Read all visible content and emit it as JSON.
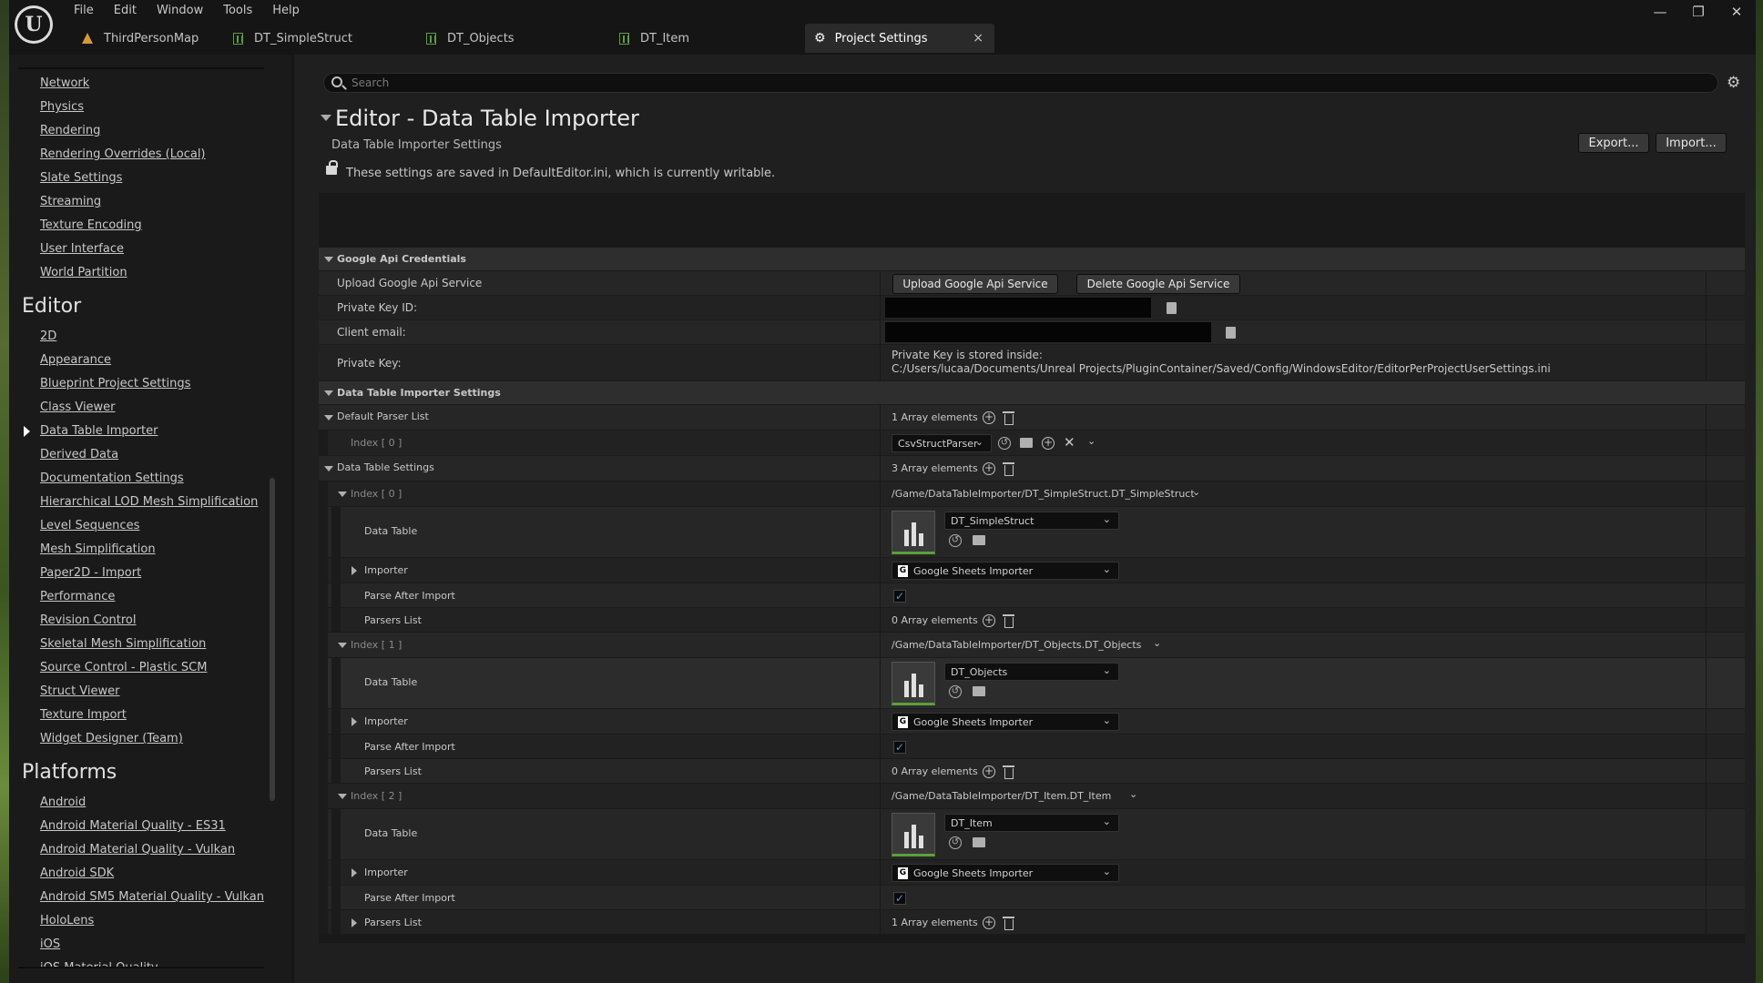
{
  "menu": [
    "File",
    "Edit",
    "Window",
    "Tools",
    "Help"
  ],
  "tabs": [
    {
      "label": "ThirdPersonMap",
      "icon": "map-icon"
    },
    {
      "label": "DT_SimpleStruct",
      "icon": "datatable-icon"
    },
    {
      "label": "DT_Objects",
      "icon": "datatable-icon"
    },
    {
      "label": "DT_Item",
      "icon": "datatable-icon"
    },
    {
      "label": "Project Settings",
      "icon": "settings-icon",
      "active": true
    }
  ],
  "sidebar": {
    "top_items": [
      "Network",
      "Physics",
      "Rendering",
      "Rendering Overrides (Local)",
      "Slate Settings",
      "Streaming",
      "Texture Encoding",
      "User Interface",
      "World Partition"
    ],
    "editor_heading": "Editor",
    "editor_items": [
      "2D",
      "Appearance",
      "Blueprint Project Settings",
      "Class Viewer",
      "Data Table Importer",
      "Derived Data",
      "Documentation Settings",
      "Hierarchical LOD Mesh Simplification",
      "Level Sequences",
      "Mesh Simplification",
      "Paper2D - Import",
      "Performance",
      "Revision Control",
      "Skeletal Mesh Simplification",
      "Source Control - Plastic SCM",
      "Struct Viewer",
      "Texture Import",
      "Widget Designer (Team)"
    ],
    "platforms_heading": "Platforms",
    "platform_items": [
      "Android",
      "Android Material Quality - ES31",
      "Android Material Quality - Vulkan",
      "Android SDK",
      "Android SM5 Material Quality - Vulkan",
      "HoloLens",
      "iOS",
      "iOS Material Quality"
    ]
  },
  "search": {
    "placeholder": "Search"
  },
  "header": {
    "title": "Editor - Data Table Importer",
    "subtitle": "Data Table Importer Settings",
    "export_label": "Export...",
    "import_label": "Import...",
    "notice": "These settings are saved in DefaultEditor.ini, which is currently writable."
  },
  "google": {
    "category": "Google Api Credentials",
    "upload_label": "Upload Google Api Service",
    "upload_button": "Upload Google Api Service",
    "delete_button": "Delete Google Api Service",
    "key_id_label": "Private Key ID:",
    "email_label": "Client email:",
    "private_key_label": "Private Key:",
    "private_key_line1": "Private Key is stored inside:",
    "private_key_line2": "C:/Users/lucaa/Documents/Unreal Projects/PluginContainer/Saved/Config/WindowsEditor/EditorPerProjectUserSettings.ini"
  },
  "dti": {
    "category": "Data Table Importer Settings",
    "default_parser_label": "Default Parser List",
    "default_parser_count": "1 Array elements",
    "parser_index_label": "Index [ 0 ]",
    "parser_value": "CsvStructParser",
    "dts_label": "Data Table Settings",
    "dts_count": "3 Array elements",
    "entries": [
      {
        "index": "Index [ 0 ]",
        "path": "/Game/DataTableImporter/DT_SimpleStruct.DT_SimpleStruct",
        "table": "DT_SimpleStruct",
        "importer": "Google Sheets Importer",
        "parsers": "0 Array elements"
      },
      {
        "index": "Index [ 1 ]",
        "path": "/Game/DataTableImporter/DT_Objects.DT_Objects",
        "table": "DT_Objects",
        "importer": "Google Sheets Importer",
        "parsers": "0 Array elements"
      },
      {
        "index": "Index [ 2 ]",
        "path": "/Game/DataTableImporter/DT_Item.DT_Item",
        "table": "DT_Item",
        "importer": "Google Sheets Importer",
        "parsers": "1 Array elements"
      }
    ],
    "data_table_label": "Data Table",
    "importer_label": "Importer",
    "parse_after_label": "Parse After Import",
    "parsers_list_label": "Parsers List"
  },
  "window": {
    "minimize": "—",
    "restore": "❐",
    "close": "✕"
  },
  "colors": {
    "accent": "#4a9bdc",
    "datatable": "#5aa03a",
    "map": "#d19a3a"
  }
}
